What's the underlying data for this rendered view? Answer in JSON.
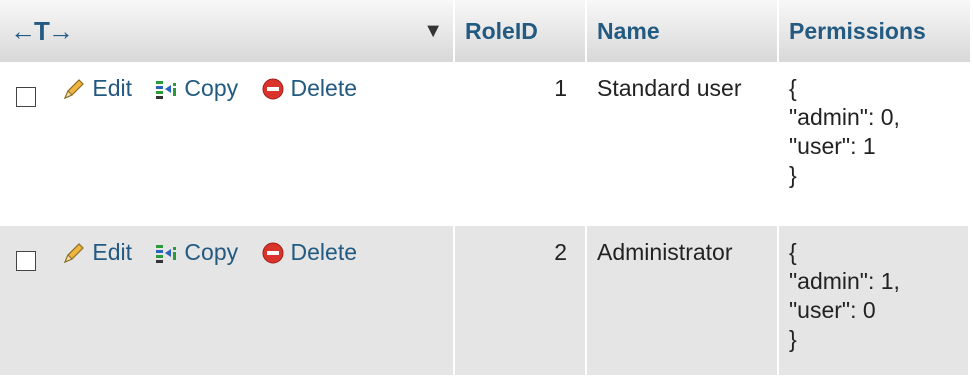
{
  "header": {
    "arrows": "←T→",
    "roleid": "RoleID",
    "name": "Name",
    "permissions": "Permissions"
  },
  "actions": {
    "edit": "Edit",
    "copy": "Copy",
    "delete": "Delete"
  },
  "rows": [
    {
      "roleid": "1",
      "name": "Standard user",
      "permissions": [
        "{",
        "\"admin\": 0,",
        "\"user\": 1",
        "}"
      ]
    },
    {
      "roleid": "2",
      "name": "Administrator",
      "permissions": [
        "{",
        "\"admin\": 1,",
        "\"user\": 0",
        "}"
      ]
    }
  ],
  "colors": {
    "link": "#235a81",
    "row_alt": "#e5e5e5",
    "delete_red": "#d9332b"
  }
}
